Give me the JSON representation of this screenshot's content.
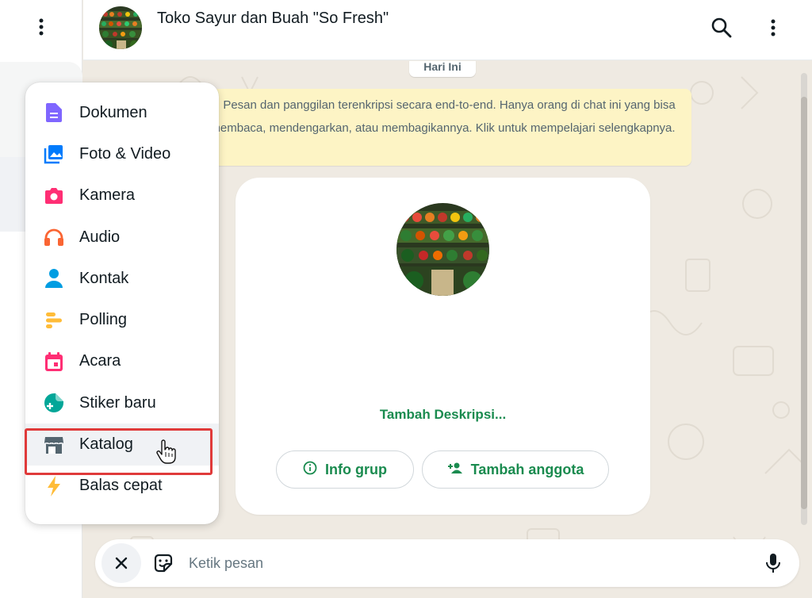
{
  "header": {
    "title": "Toko Sayur dan Buah \"So Fresh\""
  },
  "chat": {
    "date_chip": "Hari Ini",
    "encryption_notice": "Pesan dan panggilan terenkripsi secara end-to-end. Hanya orang di chat ini yang bisa membaca, mendengarkan, atau membagikannya. Klik untuk mempelajari selengkapnya.",
    "info_card": {
      "add_description": "Tambah Deskripsi...",
      "info_button": "Info grup",
      "add_member_button": "Tambah anggota"
    }
  },
  "attach_menu": {
    "items": [
      {
        "label": "Dokumen",
        "icon": "document-icon",
        "color": "#7f66ff"
      },
      {
        "label": "Foto & Video",
        "icon": "gallery-icon",
        "color": "#007bfc"
      },
      {
        "label": "Kamera",
        "icon": "camera-icon",
        "color": "#ff2e74"
      },
      {
        "label": "Audio",
        "icon": "headphones-icon",
        "color": "#fa6533"
      },
      {
        "label": "Kontak",
        "icon": "contact-icon",
        "color": "#009de2"
      },
      {
        "label": "Polling",
        "icon": "poll-icon",
        "color": "#ffbc38"
      },
      {
        "label": "Acara",
        "icon": "calendar-icon",
        "color": "#ff2e74"
      },
      {
        "label": "Stiker baru",
        "icon": "new-sticker-icon",
        "color": "#02a698"
      },
      {
        "label": "Katalog",
        "icon": "catalog-icon",
        "color": "#54656f"
      },
      {
        "label": "Balas cepat",
        "icon": "lightning-icon",
        "color": "#ffbc38"
      }
    ],
    "highlighted_item": "Katalog"
  },
  "composer": {
    "placeholder": "Ketik pesan"
  },
  "colors": {
    "accent_green": "#1a8b4f",
    "chat_background": "#efeae2",
    "notice_background": "#fdf4c5",
    "highlight_border": "#e03a3a"
  }
}
